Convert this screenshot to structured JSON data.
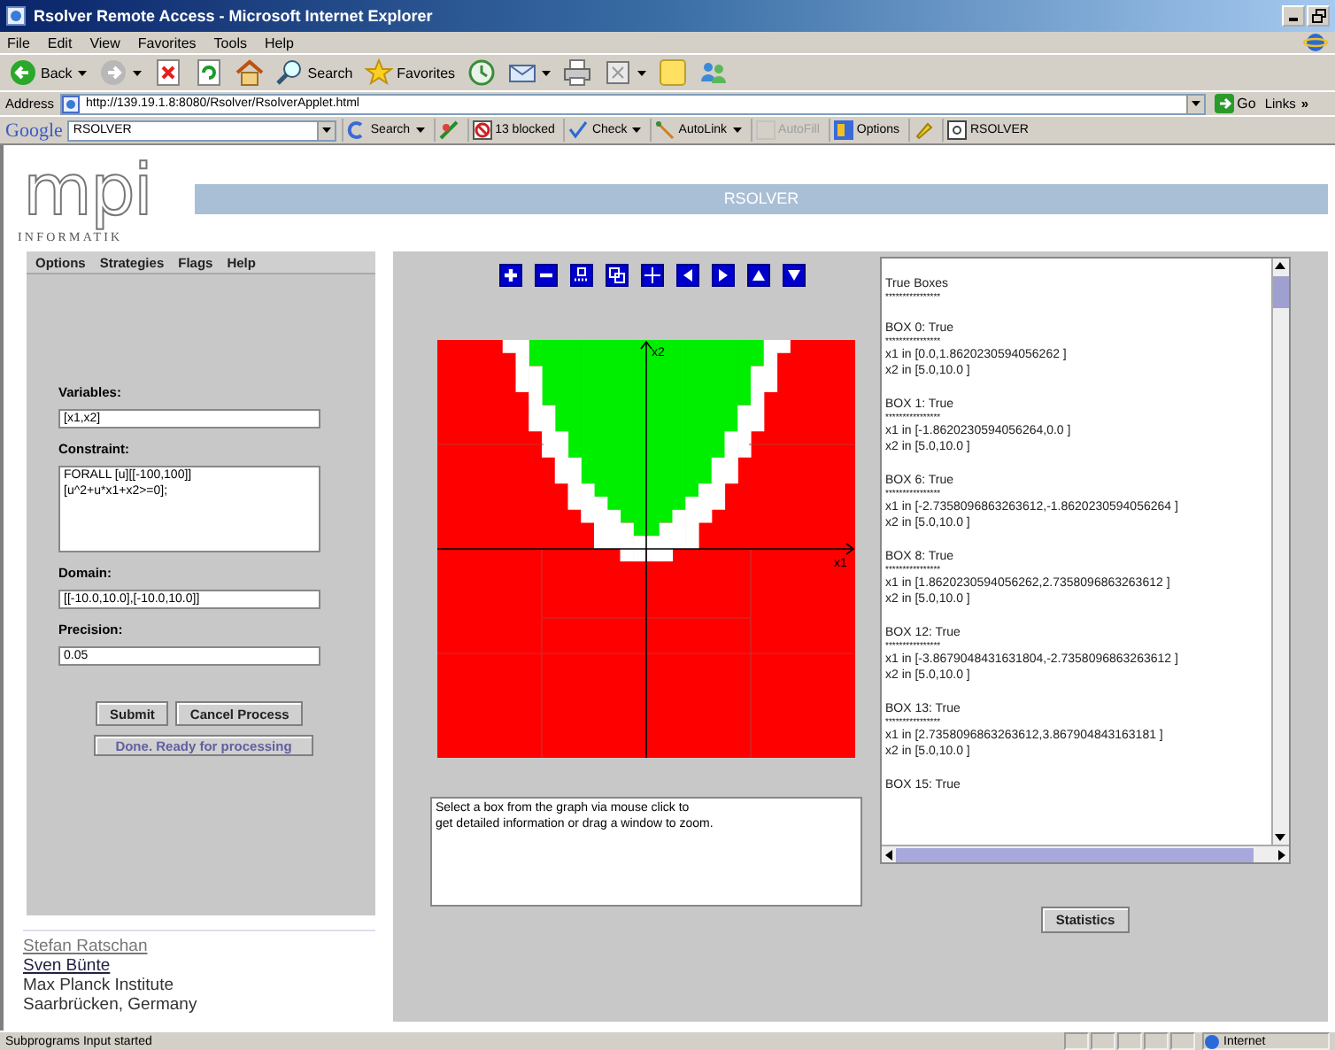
{
  "window": {
    "title": "Rsolver Remote Access - Microsoft Internet Explorer"
  },
  "menu": [
    "File",
    "Edit",
    "View",
    "Favorites",
    "Tools",
    "Help"
  ],
  "toolbar": [
    {
      "kind": "back",
      "label": "Back",
      "dropdown": true
    },
    {
      "kind": "forward",
      "dropdown": true
    },
    {
      "kind": "stop",
      "dropdown": false
    },
    {
      "kind": "refresh",
      "dropdown": false
    },
    {
      "kind": "home",
      "dropdown": false
    },
    {
      "kind": "search",
      "label": "Search",
      "dropdown": false
    },
    {
      "kind": "favorites",
      "label": "Favorites",
      "dropdown": false
    },
    {
      "kind": "history",
      "dropdown": false
    },
    {
      "kind": "mail",
      "dropdown": true
    },
    {
      "kind": "print",
      "dropdown": false
    },
    {
      "kind": "edit",
      "dropdown": true
    },
    {
      "kind": "note",
      "dropdown": false
    },
    {
      "kind": "people",
      "dropdown": false
    }
  ],
  "address": {
    "label": "Address",
    "url": "http://139.19.1.8:8080/Rsolver/RsolverApplet.html",
    "go": "Go",
    "links": "Links",
    "chevron": "»"
  },
  "google_bar": {
    "logo": "Google",
    "query": "RSOLVER",
    "items": [
      {
        "kind": "search",
        "label": "Search",
        "dropdown": true,
        "disabled": false
      },
      {
        "kind": "pagerank",
        "dropdown": false,
        "disabled": false
      },
      {
        "kind": "blocked",
        "label": "13 blocked",
        "dropdown": false,
        "disabled": false
      },
      {
        "kind": "check",
        "label": "Check",
        "dropdown": true,
        "disabled": false
      },
      {
        "kind": "autolink",
        "label": "AutoLink",
        "dropdown": true,
        "disabled": false
      },
      {
        "kind": "autofill",
        "label": "AutoFill",
        "dropdown": false,
        "disabled": true
      },
      {
        "kind": "options",
        "label": "Options",
        "dropdown": false,
        "disabled": false
      },
      {
        "kind": "highlight",
        "dropdown": false,
        "disabled": false
      },
      {
        "kind": "term",
        "label": "RSOLVER",
        "dropdown": false,
        "disabled": false
      }
    ]
  },
  "logo": {
    "mark": "mpi",
    "caption": "INFORMATIK"
  },
  "header": "RSOLVER",
  "applet_menu": [
    "Options",
    "Strategies",
    "Flags",
    "Help"
  ],
  "form": {
    "variables": {
      "label": "Variables:",
      "value": "[x1,x2]"
    },
    "constraint": {
      "label": "Constraint:",
      "lines": [
        "FORALL [u][[-100,100]]",
        "[u^2+u*x1+x2>=0];"
      ]
    },
    "domain": {
      "label": "Domain:",
      "value": "[[-10.0,10.0],[-10.0,10.0]]"
    },
    "precision": {
      "label": "Precision:",
      "value": "0.05"
    },
    "buttons": [
      "Submit",
      "Cancel Process"
    ],
    "status": {
      "label": "Done. Ready for processing",
      "disabled": true
    }
  },
  "credits": [
    {
      "kind": "link",
      "text": "Stefan Ratschan",
      "visited": true
    },
    {
      "kind": "link",
      "text": "Sven Bünte",
      "visited": false
    },
    {
      "kind": "text",
      "text": "Max Planck Institute"
    },
    {
      "kind": "text",
      "text": "Saarbrücken, Germany"
    }
  ],
  "plot_tools": [
    {
      "kind": "zoom-in"
    },
    {
      "kind": "zoom-out"
    },
    {
      "kind": "zoom-fit"
    },
    {
      "kind": "zoom-window"
    },
    {
      "kind": "crosshair"
    },
    {
      "kind": "left"
    },
    {
      "kind": "right"
    },
    {
      "kind": "up"
    },
    {
      "kind": "down"
    }
  ],
  "plot": {
    "x_label": "x1",
    "y_label": "x2"
  },
  "info": "Select a box from the graph via mouse click to\nget detailed information or drag a window to zoom.",
  "results": {
    "heading": "True Boxes",
    "rule": "****************",
    "boxes": [
      {
        "title": "BOX 0: True",
        "rule": "****************",
        "lines": [
          "x1 in  [0.0,1.8620230594056262 ]",
          "x2 in  [5.0,10.0 ]"
        ]
      },
      {
        "title": "BOX 1: True",
        "rule": "****************",
        "lines": [
          "x1 in  [-1.8620230594056264,0.0 ]",
          "x2 in  [5.0,10.0 ]"
        ]
      },
      {
        "title": "BOX 6: True",
        "rule": "****************",
        "lines": [
          "x1 in  [-2.7358096863263612,-1.8620230594056264 ]",
          "x2 in  [5.0,10.0 ]"
        ]
      },
      {
        "title": "BOX 8: True",
        "rule": "****************",
        "lines": [
          "x1 in  [1.8620230594056262,2.7358096863263612 ]",
          "x2 in  [5.0,10.0 ]"
        ]
      },
      {
        "title": "BOX 12: True",
        "rule": "****************",
        "lines": [
          "x1 in  [-3.8679048431631804,-2.7358096863263612 ]",
          "x2 in  [5.0,10.0 ]"
        ]
      },
      {
        "title": "BOX 13: True",
        "rule": "****************",
        "lines": [
          "x1 in  [2.7358096863263612,3.867904843163181 ]",
          "x2 in  [5.0,10.0 ]"
        ]
      },
      {
        "title": "BOX 15: True"
      }
    ]
  },
  "statistics": "Statistics",
  "status_bar": {
    "text": "Subprograms Input started",
    "zone": "Internet"
  }
}
